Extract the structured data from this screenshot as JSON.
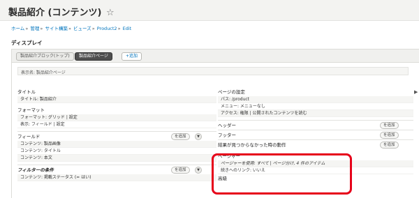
{
  "header": {
    "title": "製品紹介 (コンテンツ)",
    "star": "☆"
  },
  "breadcrumb": [
    "ホーム",
    "管理",
    "サイト構築",
    "ビューズ",
    "Product2",
    "Edit"
  ],
  "section_title": "ディスプレイ",
  "tabs": [
    {
      "label": "製品紹介ブロック(トップ)"
    },
    {
      "label": "製品紹介ページ"
    },
    {
      "label": "+追加"
    }
  ],
  "display_name": "表示名: 製品紹介ページ",
  "left": {
    "title_head": "タイトル",
    "title_value": "タイトル: 製品紹介",
    "format_head": "フォーマット",
    "format_line1": "フォーマット: グリッド | 設定",
    "format_line2": "表示: フィールド | 設定",
    "fields_head": "フィールド",
    "fields": [
      "コンテンツ: 製品画像",
      "コンテンツ: タイトル",
      "コンテンツ: 本文"
    ],
    "filter_head": "フィルターの条件",
    "filters": [
      "コンテンツ: 掲載ステータス (= はい)"
    ],
    "add_label": "を追加"
  },
  "right": {
    "page_settings_head": "ページの設定",
    "path": "パス: /product",
    "menu": "メニュー: メニューなし",
    "access": "アクセス: 権限 | 公開されたコンテンツを読む",
    "header_head": "ヘッダー",
    "footer_head": "フッター",
    "noresult_head": "結果が見つからなかった時の動作",
    "pager_head": "ページャー",
    "pager_use": "ページャーを使用: すべて | ページ分け, 4 件のアイテム",
    "pager_more": "続きへのリンク: いいえ",
    "advanced": "高級",
    "add_label": "を追加"
  },
  "colors": {
    "link": "#0074bd",
    "highlight": "#e6001a"
  }
}
